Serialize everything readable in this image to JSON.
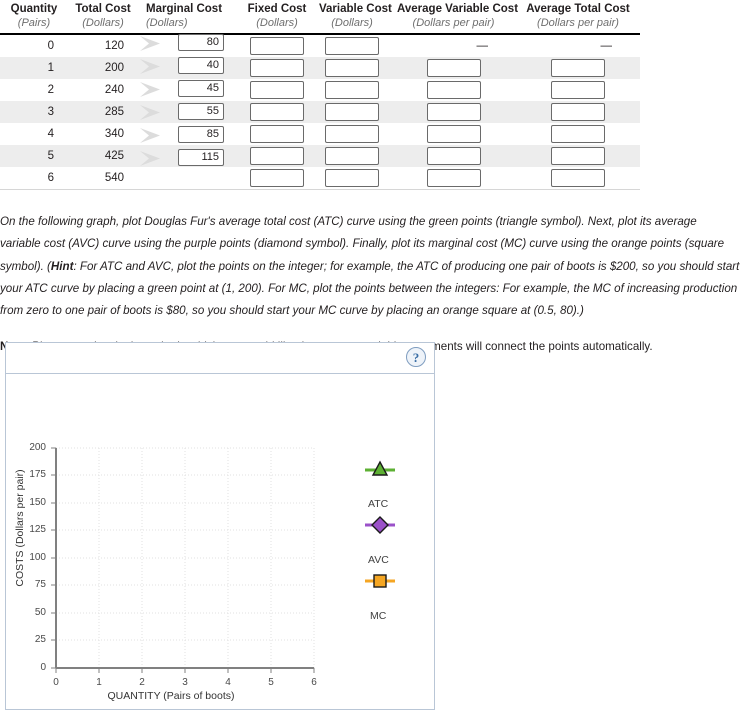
{
  "table": {
    "columns": [
      {
        "title": "Quantity",
        "unit": "(Pairs)"
      },
      {
        "title": "Total Cost",
        "unit": "(Dollars)"
      },
      {
        "title": "Marginal Cost",
        "unit": "(Dollars)"
      },
      {
        "title": "Fixed Cost",
        "unit": "(Dollars)"
      },
      {
        "title": "Variable Cost",
        "unit": "(Dollars)"
      },
      {
        "title": "Average Variable Cost",
        "unit": "(Dollars per pair)"
      },
      {
        "title": "Average Total Cost",
        "unit": "(Dollars per pair)"
      }
    ],
    "rows": [
      {
        "quantity": "0",
        "total_cost": "120",
        "fixed_cost": "",
        "variable_cost": "",
        "avc": "—",
        "atc": "—"
      },
      {
        "quantity": "1",
        "total_cost": "200",
        "fixed_cost": "",
        "variable_cost": "",
        "avc": "",
        "atc": ""
      },
      {
        "quantity": "2",
        "total_cost": "240",
        "fixed_cost": "",
        "variable_cost": "",
        "avc": "",
        "atc": ""
      },
      {
        "quantity": "3",
        "total_cost": "285",
        "fixed_cost": "",
        "variable_cost": "",
        "avc": "",
        "atc": ""
      },
      {
        "quantity": "4",
        "total_cost": "340",
        "fixed_cost": "",
        "variable_cost": "",
        "avc": "",
        "atc": ""
      },
      {
        "quantity": "5",
        "total_cost": "425",
        "fixed_cost": "",
        "variable_cost": "",
        "avc": "",
        "atc": ""
      },
      {
        "quantity": "6",
        "total_cost": "540",
        "fixed_cost": "",
        "variable_cost": "",
        "avc": "",
        "atc": ""
      }
    ],
    "marginal_costs": [
      "80",
      "40",
      "45",
      "55",
      "85",
      "115"
    ]
  },
  "instructions": {
    "paragraph": "On the following graph, plot Douglas Fur's average total cost (ATC) curve using the green points (triangle symbol). Next, plot its average variable cost (AVC) curve using the purple points (diamond symbol). Finally, plot its marginal cost (MC) curve using the orange points (square symbol). (",
    "hint_label": "Hint",
    "paragraph_hint": ": For ATC and AVC, plot the points on the integer; for example, the ATC of producing one pair of boots is $200, so you should start your ATC curve by placing a green point at (1, 200). For MC, plot the points between the integers: For example, the MC of increasing production from zero to one pair of boots is $80, so you should start your MC curve by placing an orange square at (0.5, 80).)",
    "note_label": "Note",
    "note_text": ": Plot your points in the order in which you would like them connected. Line segments will connect the points automatically."
  },
  "graph": {
    "help_label": "?",
    "legend": [
      {
        "label": "ATC",
        "symbol": "triangle",
        "color": "#5db033"
      },
      {
        "label": "AVC",
        "symbol": "diamond",
        "color": "#9b51c9"
      },
      {
        "label": "MC",
        "symbol": "square",
        "color": "#f5a623"
      }
    ]
  },
  "chart_data": {
    "type": "scatter",
    "title": "",
    "xlabel": "QUANTITY (Pairs of boots)",
    "ylabel": "COSTS (Dollars per pair)",
    "xlim": [
      0,
      6
    ],
    "ylim": [
      0,
      200
    ],
    "xticks": [
      "0",
      "1",
      "2",
      "3",
      "4",
      "5",
      "6"
    ],
    "yticks": [
      "0",
      "25",
      "50",
      "75",
      "100",
      "125",
      "150",
      "175",
      "200"
    ],
    "grid": true,
    "legend_position": "right",
    "series": [
      {
        "name": "ATC",
        "symbol": "triangle",
        "color": "#5db033",
        "x": [],
        "y": []
      },
      {
        "name": "AVC",
        "symbol": "diamond",
        "color": "#9b51c9",
        "x": [],
        "y": []
      },
      {
        "name": "MC",
        "symbol": "square",
        "color": "#f5a623",
        "x": [],
        "y": []
      }
    ]
  }
}
